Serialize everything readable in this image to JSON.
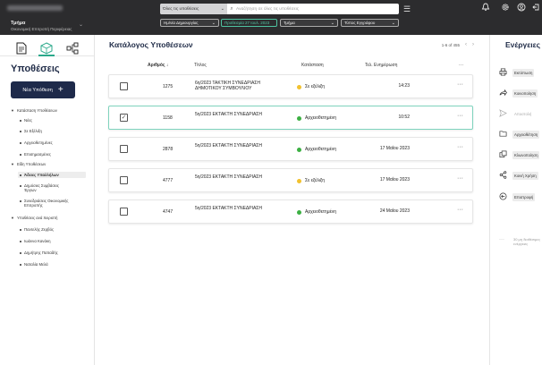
{
  "topbar": {
    "org_name": "Τμήμα",
    "org_sub": "Οικονομική Επιτροπή Περιφέρειας",
    "search_scope": "Όλες τις υποθέσεις",
    "search_placeholder": "Αναζήτηση σε όλες τις υποθέσεις",
    "chips": [
      {
        "label": "Ημ/νία Δημιουργίας",
        "kind": "normal"
      },
      {
        "label": "Προθεσμία 27 Ιουλ. 2023",
        "kind": "date"
      },
      {
        "label": "Τμήμα",
        "kind": "normal"
      },
      {
        "label": "Τύπος Εγγράφου",
        "kind": "normal"
      }
    ],
    "icons": [
      "bell-icon",
      "gear-icon",
      "user-icon",
      "logout-icon"
    ]
  },
  "sidebar": {
    "title": "Υποθέσεις",
    "new_button": "Νέα Υπόθεση",
    "tree": [
      {
        "label": "Κατάσταση Υποθέσεων",
        "level": 0
      },
      {
        "label": "Νέες",
        "level": 1
      },
      {
        "label": "Σε Εξέλιξη",
        "level": 1
      },
      {
        "label": "Αρχειοθετημένες",
        "level": 1
      },
      {
        "label": "Επισημασμένες",
        "level": 1
      },
      {
        "label": "Είδη Υποθέσεων",
        "level": 0
      },
      {
        "label": "Άδειες Υπαλλήλων",
        "level": 1,
        "selected": true
      },
      {
        "label": "Δημόσιες Συμβάσεις",
        "label2": "Έργων",
        "level": 1
      },
      {
        "label": "Συνεδριάσεις Οικονομικής",
        "label2": "Επιτροπής",
        "level": 1
      },
      {
        "label": "Υποθέσεις ανά Χειριστή",
        "level": 0
      },
      {
        "label": "Παντελής Ζερβός",
        "level": 1
      },
      {
        "label": "Ιωάννα Κανάκη",
        "level": 1
      },
      {
        "label": "Δημήτρης Παπαδής",
        "level": 1
      },
      {
        "label": "Ναταλία Μελά",
        "level": 1
      }
    ]
  },
  "main": {
    "title": "Κατάλογος Υποθέσεων",
    "pager": "1-6 of 455",
    "columns": {
      "num": "Αριθμός",
      "title": "Τίτλος",
      "status": "Κατάσταση",
      "updated": "Τελ. Ενημέρωση",
      "more": "···"
    },
    "rows": [
      {
        "num": "1275",
        "title": "6η/2023 ΤΑΚΤΙΚΗ ΣΥΝΕΔΡΙΑΣΗ ΔΗΜΟΤΙΚΟΥ ΣΥΜΒΟΥΛΙΟΥ",
        "status": "Σε εξέλιξη",
        "status_color": "#f2c12e",
        "date": "14:23",
        "checked": false
      },
      {
        "num": "1158",
        "title": "5η/2023 ΕΚΤΑΚΤΗ ΣΥΝΕΔΡΙΑΣΗ",
        "status": "Αρχειοθετημένη",
        "status_color": "#3cb043",
        "date": "10:52",
        "checked": true
      },
      {
        "num": "2878",
        "title": "5η/2023 ΕΚΤΑΚΤΗ ΣΥΝΕΔΡΙΑΣΗ",
        "status": "Αρχειοθετημένη",
        "status_color": "#3cb043",
        "date": "17 Μαΐου 2023",
        "checked": false
      },
      {
        "num": "4777",
        "title": "5η/2023 ΕΚΤΑΚΤΗ ΣΥΝΕΔΡΙΑΣΗ",
        "status": "Σε εξέλιξη",
        "status_color": "#f2c12e",
        "date": "17 Μαΐου 2023",
        "checked": false
      },
      {
        "num": "4747",
        "title": "5η/2023 ΕΚΤΑΚΤΗ ΣΥΝΕΔΡΙΑΣΗ",
        "status": "Αρχειοθετημένη",
        "status_color": "#3cb043",
        "date": "24 Μαΐου 2023",
        "checked": false
      }
    ]
  },
  "rpanel": {
    "title": "Ενέργειες",
    "actions": [
      {
        "label": "Εκτύπωση",
        "icon": "print-icon",
        "disabled": false
      },
      {
        "label": "Κοινοποίηση",
        "icon": "share-arrow-icon",
        "disabled": false
      },
      {
        "label": "Αποστολή",
        "icon": "send-icon",
        "disabled": true
      },
      {
        "label": "Αρχειοθέτηση",
        "icon": "archive-icon",
        "disabled": false
      },
      {
        "label": "Κλωνοποίηση",
        "icon": "clone-icon",
        "disabled": false
      },
      {
        "label": "Κοινή Χρήση",
        "icon": "share-nodes-icon",
        "disabled": false
      },
      {
        "label": "Επιστροφή",
        "icon": "return-icon",
        "disabled": false
      }
    ],
    "note": "30 μη διαθέσιμες ενέργειες"
  }
}
